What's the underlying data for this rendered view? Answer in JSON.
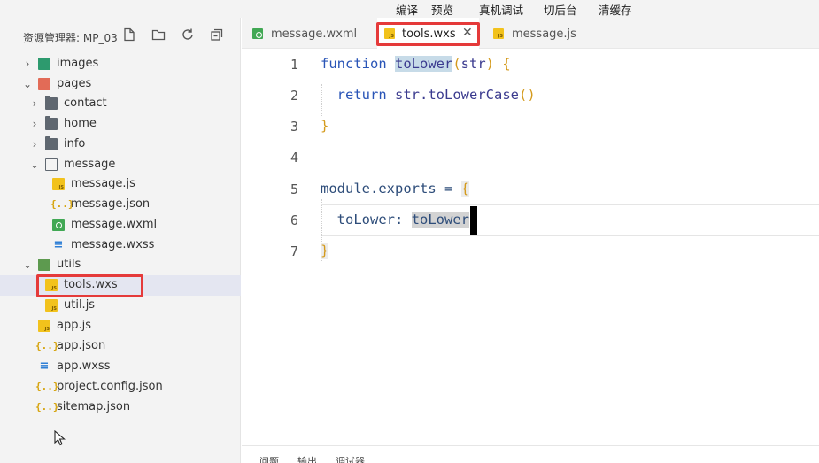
{
  "toolbar": {
    "compile": "编译",
    "preview": "预览",
    "remote_debug": "真机调试",
    "background": "切后台",
    "clear_cache": "清缓存"
  },
  "explorer": {
    "title": "资源管理器: MP_03",
    "tools": [
      "new-file-icon",
      "new-folder-icon",
      "refresh-icon",
      "collapse-all-icon"
    ],
    "items": [
      {
        "label": "images",
        "type": "folder",
        "depth": 0,
        "expanded": false
      },
      {
        "label": "pages",
        "type": "folder",
        "depth": 0,
        "expanded": true
      },
      {
        "label": "contact",
        "type": "folder",
        "depth": 1,
        "expanded": false
      },
      {
        "label": "home",
        "type": "folder",
        "depth": 1,
        "expanded": false
      },
      {
        "label": "info",
        "type": "folder",
        "depth": 1,
        "expanded": false
      },
      {
        "label": "message",
        "type": "folder",
        "depth": 1,
        "expanded": true
      },
      {
        "label": "message.js",
        "type": "js",
        "depth": 2
      },
      {
        "label": "message.json",
        "type": "json",
        "depth": 2
      },
      {
        "label": "message.wxml",
        "type": "wxml",
        "depth": 2
      },
      {
        "label": "message.wxss",
        "type": "wxss",
        "depth": 2
      },
      {
        "label": "utils",
        "type": "folder",
        "depth": 0,
        "expanded": true
      },
      {
        "label": "tools.wxs",
        "type": "js",
        "depth": 1,
        "selected": true
      },
      {
        "label": "util.js",
        "type": "js",
        "depth": 1
      },
      {
        "label": "app.js",
        "type": "js",
        "depth": 0
      },
      {
        "label": "app.json",
        "type": "json",
        "depth": 0
      },
      {
        "label": "app.wxss",
        "type": "wxss",
        "depth": 0
      },
      {
        "label": "project.config.json",
        "type": "json",
        "depth": 0
      },
      {
        "label": "sitemap.json",
        "type": "json",
        "depth": 0
      }
    ]
  },
  "tabs": [
    {
      "label": "message.wxml",
      "type": "wxml",
      "active": false
    },
    {
      "label": "tools.wxs",
      "type": "js",
      "active": true,
      "close": "✕"
    },
    {
      "label": "message.js",
      "type": "js",
      "active": false
    }
  ],
  "editor": {
    "line_numbers": [
      "1",
      "2",
      "3",
      "4",
      "5",
      "6",
      "7"
    ],
    "lines": {
      "l1_kw": "function",
      "l1_name": "toLower",
      "l1_paren_open": "(",
      "l1_param": "str",
      "l1_paren_close": ")",
      "l1_brace": "{",
      "l2_kw": "return",
      "l2_expr": "str.toLowerCase",
      "l2_parens": "()",
      "l3_brace": "}",
      "l5_expr": "module.exports = ",
      "l5_brace": "{",
      "l6_key": "toLower: ",
      "l6_val": "toLower",
      "l7_brace": "}"
    }
  },
  "bottom_panel": {
    "tabs": [
      "问题",
      "输出",
      "调试器"
    ]
  },
  "colors": {
    "highlight_red": "#e53a3a",
    "selected_row": "#e4e6f1",
    "keyword": "#2a55b7",
    "bracket": "#d49a1c"
  }
}
